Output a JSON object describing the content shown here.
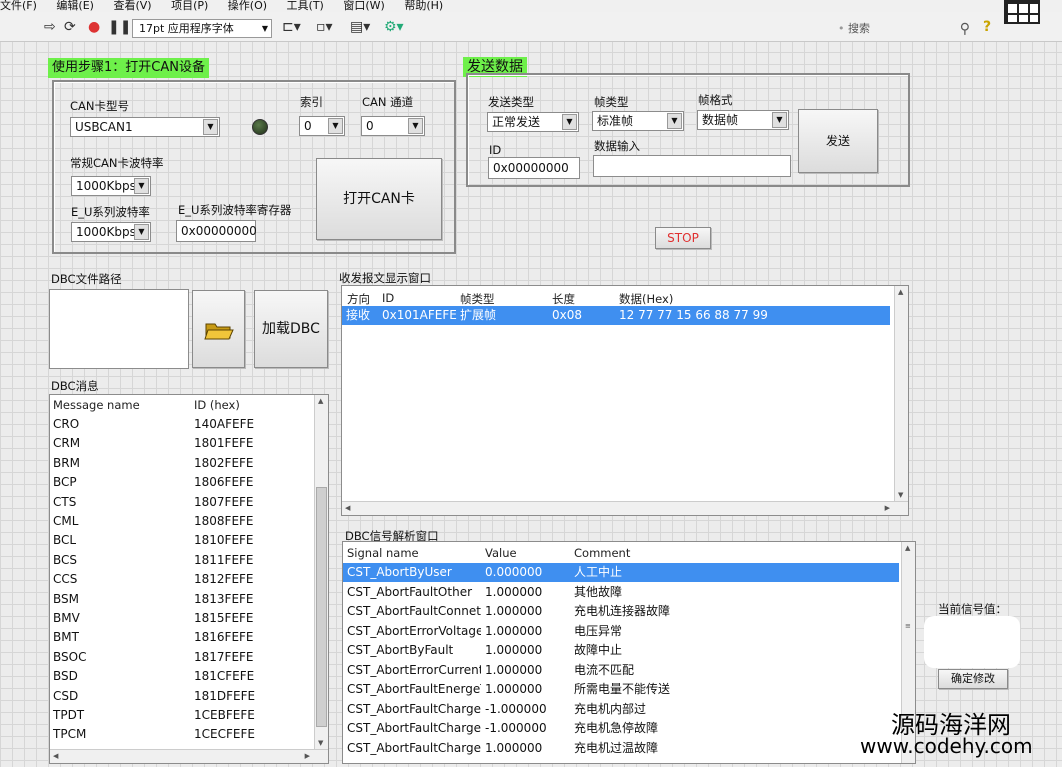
{
  "menu": [
    "文件(F)",
    "编辑(E)",
    "查看(V)",
    "项目(P)",
    "操作(O)",
    "工具(T)",
    "窗口(W)",
    "帮助(H)"
  ],
  "toolbar": {
    "font": "17pt 应用程序字体",
    "search_placeholder": "搜索"
  },
  "step1": {
    "title": "使用步骤1：打开CAN设备",
    "card_type_label": "CAN卡型号",
    "card_type_value": "USBCAN1",
    "index_label": "索引",
    "index_value": "0",
    "channel_label": "CAN 通道",
    "channel_value": "0",
    "baud_label": "常规CAN卡波特率",
    "baud_value": "1000Kbps",
    "eu_baud_label": "E_U系列波特率",
    "eu_baud_value": "1000Kbps",
    "eu_reg_label": "E_U系列波特率寄存器",
    "eu_reg_value": "0x00000000",
    "open_button": "打开CAN卡"
  },
  "send": {
    "title": "发送数据",
    "send_type_label": "发送类型",
    "send_type_value": "正常发送",
    "frame_type_label": "帧类型",
    "frame_type_value": "标准帧",
    "frame_format_label": "帧格式",
    "frame_format_value": "数据帧",
    "send_button": "发送",
    "id_label": "ID",
    "id_value": "0x00000000",
    "data_label": "数据输入",
    "data_value": ""
  },
  "stop_button": "STOP",
  "dbc_path": {
    "label": "DBC文件路径",
    "load_button": "加载DBC"
  },
  "msg_window": {
    "label": "收发报文显示窗口",
    "headers": [
      "方向",
      "ID",
      "帧类型",
      "长度",
      "数据(Hex)"
    ],
    "rows": [
      [
        "接收",
        "0x101AFEFE",
        "扩展帧",
        "0x08",
        "12 77 77 15 66 88 77 99"
      ]
    ]
  },
  "dbc_messages": {
    "label": "DBC消息",
    "headers": [
      "Message name",
      "ID (hex)"
    ],
    "rows": [
      [
        "CRO",
        "140AFEFE"
      ],
      [
        "CRM",
        "1801FEFE"
      ],
      [
        "BRM",
        "1802FEFE"
      ],
      [
        "BCP",
        "1806FEFE"
      ],
      [
        "CTS",
        "1807FEFE"
      ],
      [
        "CML",
        "1808FEFE"
      ],
      [
        "BCL",
        "1810FEFE"
      ],
      [
        "BCS",
        "1811FEFE"
      ],
      [
        "CCS",
        "1812FEFE"
      ],
      [
        "BSM",
        "1813FEFE"
      ],
      [
        "BMV",
        "1815FEFE"
      ],
      [
        "BMT",
        "1816FEFE"
      ],
      [
        "BSOC",
        "1817FEFE"
      ],
      [
        "BSD",
        "181CFEFE"
      ],
      [
        "CSD",
        "181DFEFE"
      ],
      [
        "TPDT",
        "1CEBFEFE"
      ],
      [
        "TPCM",
        "1CECFEFE"
      ]
    ]
  },
  "signal_window": {
    "label": "DBC信号解析窗口",
    "headers": [
      "Signal name",
      "Value",
      "Comment"
    ],
    "rows": [
      [
        "CST_AbortByUser",
        "0.000000",
        "人工中止"
      ],
      [
        "CST_AbortFaultOther",
        "1.000000",
        "其他故障"
      ],
      [
        "CST_AbortFaultConneto",
        "1.000000",
        "充电机连接器故障"
      ],
      [
        "CST_AbortErrorVoltage",
        "1.000000",
        "电压异常"
      ],
      [
        "CST_AbortByFault",
        "1.000000",
        "故障中止"
      ],
      [
        "CST_AbortErrorCurrent",
        "1.000000",
        "电流不匹配"
      ],
      [
        "CST_AbortFaultEnergeT",
        "1.000000",
        "所需电量不能传送"
      ],
      [
        "CST_AbortFaultCharger",
        "-1.000000",
        "充电机内部过"
      ],
      [
        "CST_AbortFaultCharger",
        "-1.000000",
        "充电机急停故障"
      ],
      [
        "CST_AbortFaultCharger",
        "1.000000",
        "充电机过温故障"
      ]
    ]
  },
  "current_signal": {
    "label": "当前信号值：",
    "confirm_button": "确定修改"
  },
  "watermark": {
    "line1": "源码海洋网",
    "line2": "www.codehy.com"
  }
}
